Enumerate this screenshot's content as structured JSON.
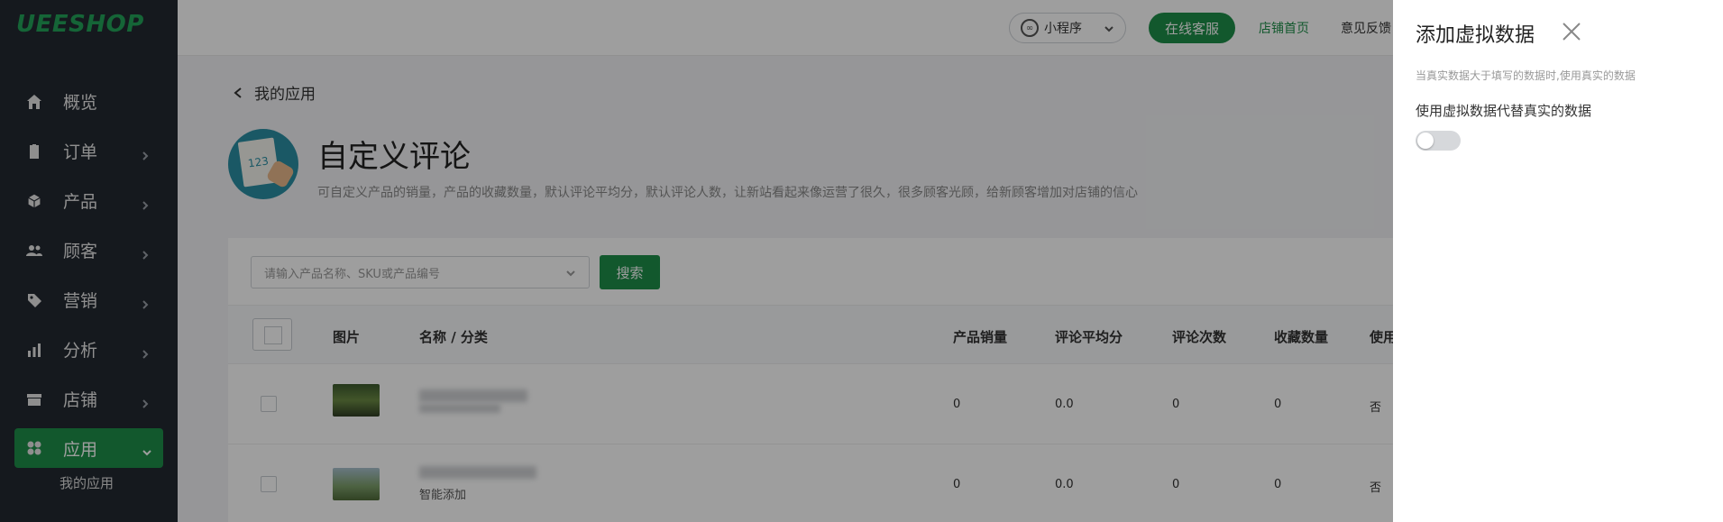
{
  "brand": {
    "logo": "UEESHOP",
    "accent": "#1e8f49"
  },
  "sidebar": {
    "items": [
      {
        "label": "概览",
        "icon": "home-icon"
      },
      {
        "label": "订单",
        "icon": "clipboard-icon"
      },
      {
        "label": "产品",
        "icon": "box-icon"
      },
      {
        "label": "顾客",
        "icon": "users-icon"
      },
      {
        "label": "营销",
        "icon": "tag-icon"
      },
      {
        "label": "分析",
        "icon": "bar-chart-icon"
      },
      {
        "label": "店铺",
        "icon": "store-icon"
      },
      {
        "label": "应用",
        "icon": "apps-icon"
      }
    ],
    "sub_items": [
      "我的应用"
    ]
  },
  "topbar": {
    "mini_program": "小程序",
    "online_service": "在线客服",
    "shop_home": "店铺首页",
    "feedback": "意见反馈"
  },
  "page": {
    "back_label": "我的应用",
    "title": "自定义评论",
    "description": "可自定义产品的销量，产品的收藏数量，默认评论平均分，默认评论人数，让新站看起来像运营了很久，很多顾客光顾，给新顾客增加对店铺的信心",
    "app_icon_text": "123"
  },
  "search": {
    "placeholder": "请输入产品名称、SKU或产品编号",
    "button": "搜索"
  },
  "table": {
    "columns": [
      "图片",
      "名称 / 分类",
      "产品销量",
      "评论平均分",
      "评论次数",
      "收藏数量",
      "使用"
    ],
    "rows": [
      {
        "category": "",
        "sales": "0",
        "avg_score": "0.0",
        "review_count": "0",
        "favorites": "0",
        "use": "否"
      },
      {
        "category": "智能添加",
        "sales": "0",
        "avg_score": "0.0",
        "review_count": "0",
        "favorites": "0",
        "use": "否"
      }
    ]
  },
  "drawer": {
    "title": "添加虚拟数据",
    "hint": "当真实数据大于填写的数据时,使用真实的数据",
    "toggle_label": "使用虚拟数据代替真实的数据",
    "toggle_on": false
  }
}
